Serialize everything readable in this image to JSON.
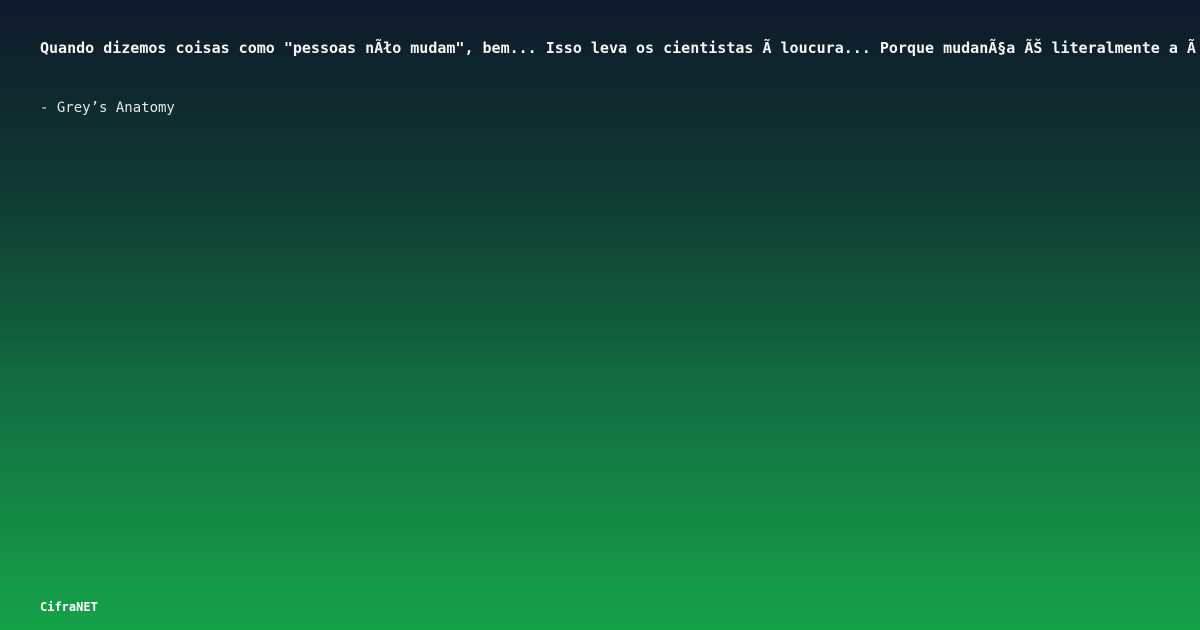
{
  "quote": {
    "text": "Quando dizemos coisas como \"pessoas nÃło mudam\", bem... Isso leva os cientistas Ã  loucura... Porque mudanÃ§a ÃŠ literalmente a Ã"
  },
  "author": {
    "text": "- Grey’s Anatomy"
  },
  "brand": {
    "name": "CifraNET"
  },
  "colors": {
    "background_top": "#0e192b",
    "background_bottom": "#15a248",
    "text": "#f5f5f5"
  }
}
